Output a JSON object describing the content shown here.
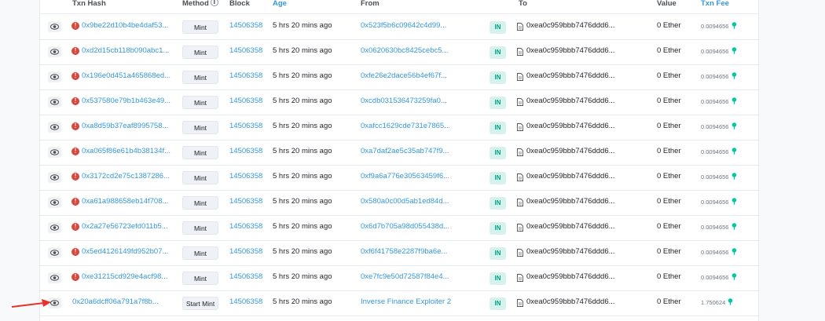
{
  "columns": {
    "txn_hash": "Txn Hash",
    "method": "Method",
    "block": "Block",
    "age": "Age",
    "from": "From",
    "to": "To",
    "value": "Value",
    "txn_fee": "Txn Fee"
  },
  "rows": [
    {
      "error": true,
      "hash": "0x9be22d10b4be4daf53...",
      "method": "Mint",
      "block": "14506358",
      "age": "5 hrs 20 mins ago",
      "from": "0x523f5b6c09642c4d99...",
      "direction": "IN",
      "to": "0xea0c959bbb7476ddd6...",
      "value": "0 Ether",
      "fee": "0.0094656"
    },
    {
      "error": true,
      "hash": "0xd2d15cb118b090abc1...",
      "method": "Mint",
      "block": "14506358",
      "age": "5 hrs 20 mins ago",
      "from": "0x0620630bc8425cebc5...",
      "direction": "IN",
      "to": "0xea0c959bbb7476ddd6...",
      "value": "0 Ether",
      "fee": "0.0094656"
    },
    {
      "error": true,
      "hash": "0x196e0d451a465868ed...",
      "method": "Mint",
      "block": "14506358",
      "age": "5 hrs 20 mins ago",
      "from": "0xfe26e2dace56b4ef67f...",
      "direction": "IN",
      "to": "0xea0c959bbb7476ddd6...",
      "value": "0 Ether",
      "fee": "0.0094656"
    },
    {
      "error": true,
      "hash": "0x537580e79b1b463e49...",
      "method": "Mint",
      "block": "14506358",
      "age": "5 hrs 20 mins ago",
      "from": "0xcdb031536473259fa0...",
      "direction": "IN",
      "to": "0xea0c959bbb7476ddd6...",
      "value": "0 Ether",
      "fee": "0.0094656"
    },
    {
      "error": true,
      "hash": "0xa8d59b37eaf8995758...",
      "method": "Mint",
      "block": "14506358",
      "age": "5 hrs 20 mins ago",
      "from": "0xafcc1629cde731e7865...",
      "direction": "IN",
      "to": "0xea0c959bbb7476ddd6...",
      "value": "0 Ether",
      "fee": "0.0094656"
    },
    {
      "error": true,
      "hash": "0xa065f86e61b4b38134f...",
      "method": "Mint",
      "block": "14506358",
      "age": "5 hrs 20 mins ago",
      "from": "0xa7daf2ae5c35ab747f9...",
      "direction": "IN",
      "to": "0xea0c959bbb7476ddd6...",
      "value": "0 Ether",
      "fee": "0.0094656"
    },
    {
      "error": true,
      "hash": "0x3172cd2e75c1387286...",
      "method": "Mint",
      "block": "14506358",
      "age": "5 hrs 20 mins ago",
      "from": "0xf9a6a776e30563459f6...",
      "direction": "IN",
      "to": "0xea0c959bbb7476ddd6...",
      "value": "0 Ether",
      "fee": "0.0094656"
    },
    {
      "error": true,
      "hash": "0xa61a988658eb14f708...",
      "method": "Mint",
      "block": "14506358",
      "age": "5 hrs 20 mins ago",
      "from": "0x580a0c00d5ab1ed84d...",
      "direction": "IN",
      "to": "0xea0c959bbb7476ddd6...",
      "value": "0 Ether",
      "fee": "0.0094656"
    },
    {
      "error": true,
      "hash": "0x2a27e56723efd011b5...",
      "method": "Mint",
      "block": "14506358",
      "age": "5 hrs 20 mins ago",
      "from": "0x6d7b705a98d055438d...",
      "direction": "IN",
      "to": "0xea0c959bbb7476ddd6...",
      "value": "0 Ether",
      "fee": "0.0094656"
    },
    {
      "error": true,
      "hash": "0x5ed4126149fd952b07...",
      "method": "Mint",
      "block": "14506358",
      "age": "5 hrs 20 mins ago",
      "from": "0xf6f41758e2287f9ba6e...",
      "direction": "IN",
      "to": "0xea0c959bbb7476ddd6...",
      "value": "0 Ether",
      "fee": "0.0094656"
    },
    {
      "error": true,
      "hash": "0xe31215cd929e4acf98...",
      "method": "Mint",
      "block": "14506358",
      "age": "5 hrs 20 mins ago",
      "from": "0xe7fc9e50d72587f84e4...",
      "direction": "IN",
      "to": "0xea0c959bbb7476ddd6...",
      "value": "0 Ether",
      "fee": "0.0094656"
    },
    {
      "error": false,
      "hash": "0x20a6dcff06a791a7f8b...",
      "method": "Start Mint",
      "block": "14506358",
      "age": "5 hrs 20 mins ago",
      "from": "Inverse Finance Exploiter 2",
      "direction": "IN",
      "to": "0xea0c959bbb7476ddd6...",
      "value": "0 Ether",
      "fee": "1.750624"
    }
  ],
  "colors": {
    "link": "#3498db",
    "error": "#de4437",
    "in_badge_bg": "#d5f3ec",
    "in_badge_text": "#00a186",
    "annotation_arrow": "#e8322a"
  },
  "icons": {
    "eye": "eye-icon",
    "error": "error-icon",
    "contract": "document-icon",
    "gas": "gas-pump-icon",
    "info": "info-icon"
  }
}
